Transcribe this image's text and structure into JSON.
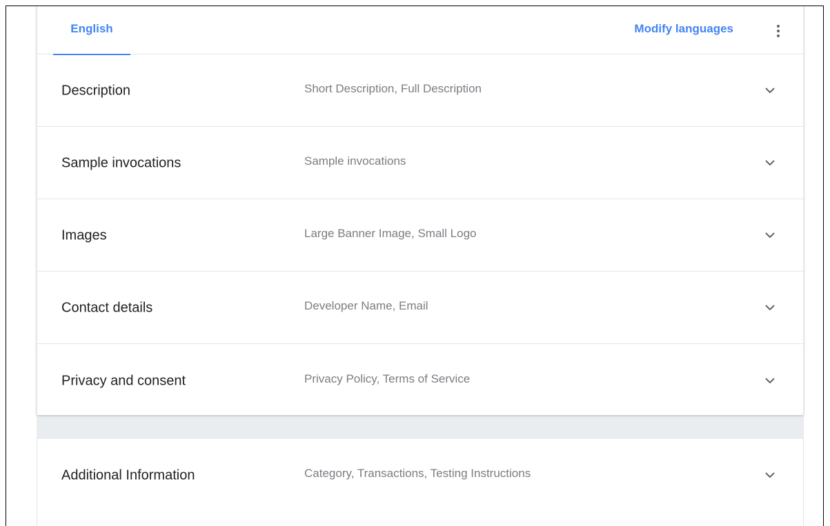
{
  "tabs": {
    "active_label": "English",
    "modify_label": "Modify languages",
    "more_icon": "more-vert-icon"
  },
  "sections": [
    {
      "title": "Description",
      "subtitle": "Short Description, Full Description",
      "icon": "chevron-down-icon"
    },
    {
      "title": "Sample invocations",
      "subtitle": "Sample invocations",
      "icon": "chevron-down-icon"
    },
    {
      "title": "Images",
      "subtitle": "Large Banner Image, Small Logo",
      "icon": "chevron-down-icon"
    },
    {
      "title": "Contact details",
      "subtitle": "Developer Name, Email",
      "icon": "chevron-down-icon"
    },
    {
      "title": "Privacy and consent",
      "subtitle": "Privacy Policy, Terms of Service",
      "icon": "chevron-down-icon"
    }
  ],
  "additional": {
    "title": "Additional Information",
    "subtitle": "Category, Transactions, Testing Instructions",
    "icon": "chevron-down-icon"
  },
  "colors": {
    "accent": "#4285f4",
    "title_text": "#202124",
    "subtitle_text": "#7a7d82",
    "divider": "#e3e5e8",
    "gap_background": "#eaedf0"
  }
}
